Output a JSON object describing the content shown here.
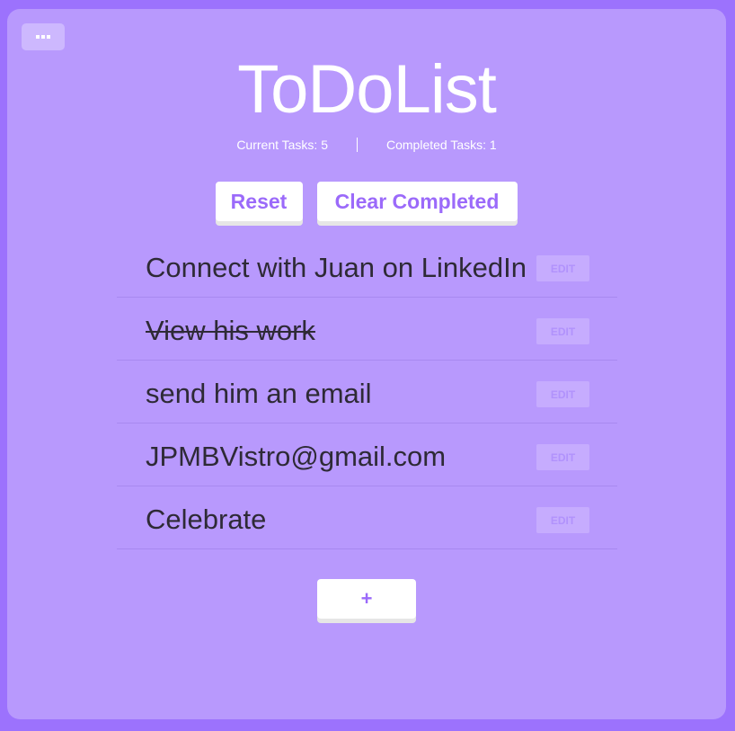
{
  "app": {
    "title": "ToDoList",
    "menu_icon": "more-dots-icon"
  },
  "stats": {
    "current_label": "Current Tasks: 5",
    "completed_label": "Completed Tasks: 1",
    "current_count": 5,
    "completed_count": 1
  },
  "actions": {
    "reset_label": "Reset",
    "clear_completed_label": "Clear Completed"
  },
  "tasks": [
    {
      "text": "Connect with Juan on LinkedIn",
      "completed": false,
      "edit_label": "EDIT"
    },
    {
      "text": "View his work",
      "completed": true,
      "edit_label": "EDIT"
    },
    {
      "text": "send him an email",
      "completed": false,
      "edit_label": "EDIT"
    },
    {
      "text": "JPMBVistro@gmail.com",
      "completed": false,
      "edit_label": "EDIT"
    },
    {
      "text": "Celebrate",
      "completed": false,
      "edit_label": "EDIT"
    }
  ],
  "add_button": {
    "label": "+",
    "icon": "plus-icon"
  },
  "colors": {
    "page_background": "#9c72fd",
    "card_background": "#b899fd",
    "accent": "#9b6afa",
    "button_background": "#ffffff",
    "task_text": "#2e2a36",
    "edit_button_background": "#c6acfe"
  }
}
